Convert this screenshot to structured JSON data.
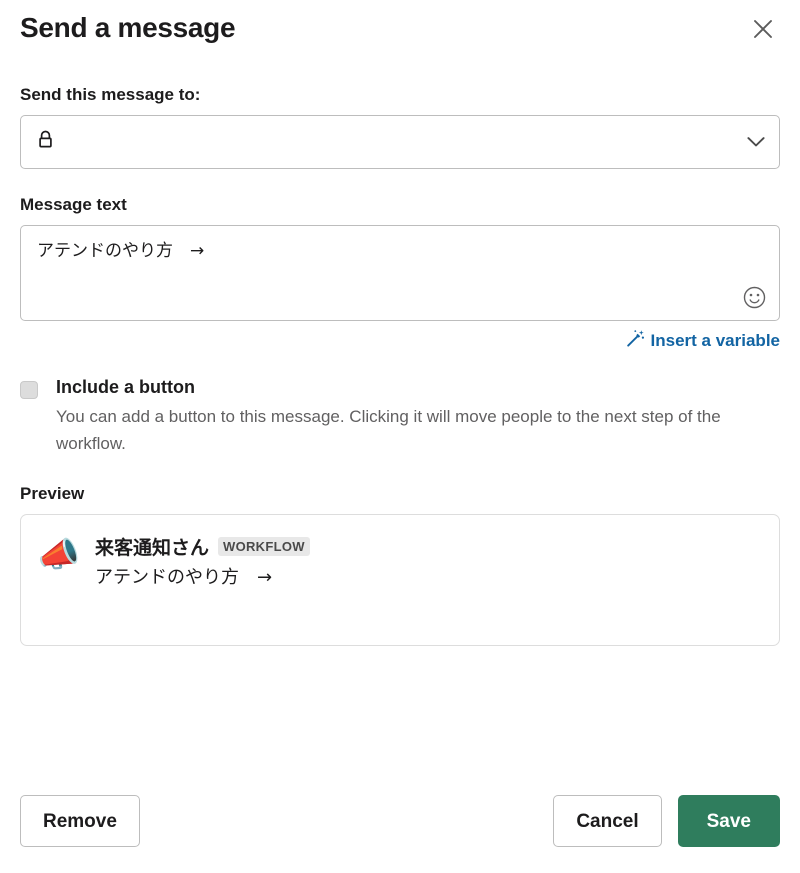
{
  "dialog": {
    "title": "Send a message",
    "close_icon": "close-icon"
  },
  "recipient": {
    "label": "Send this message to:",
    "value": "",
    "channel_icon": "lock-icon",
    "dropdown_icon": "chevron-down-icon"
  },
  "message": {
    "label": "Message text",
    "value": "アテンドのやり方　→",
    "emoji_icon": "emoji-smiley-icon",
    "insert_variable_label": "Insert a variable",
    "insert_variable_icon": "magic-wand-icon"
  },
  "include_button": {
    "label": "Include a button",
    "description": "You can add a button to this message. Clicking it will move people to the next step of the workflow.",
    "checked": false
  },
  "preview": {
    "label": "Preview",
    "avatar_icon": "megaphone-emoji",
    "author": "来客通知さん",
    "badge": "WORKFLOW",
    "body": "アテンドのやり方　→"
  },
  "footer": {
    "remove_label": "Remove",
    "cancel_label": "Cancel",
    "save_label": "Save"
  },
  "colors": {
    "primary_green": "#2f7d5d",
    "link_blue": "#1264a3",
    "border_gray": "#bdbdbd",
    "text_muted": "#616061",
    "badge_bg": "#e8e8e8"
  }
}
